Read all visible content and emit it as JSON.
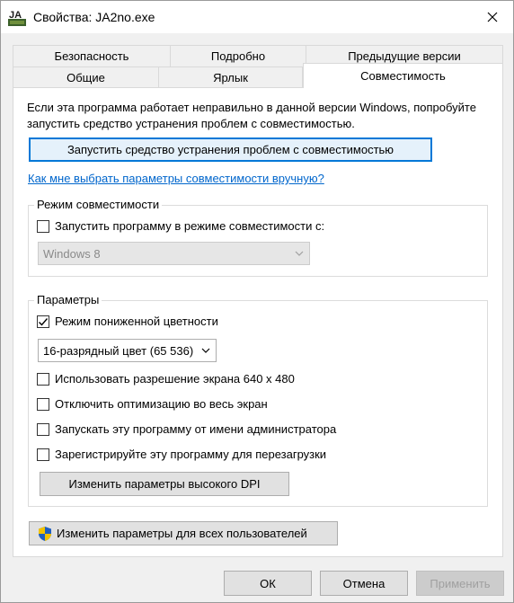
{
  "window": {
    "title": "Свойства: JA2no.exe",
    "app_icon_label": "JA"
  },
  "tabs": {
    "row1": [
      "Безопасность",
      "Подробно",
      "Предыдущие версии"
    ],
    "row2": [
      "Общие",
      "Ярлык",
      "Совместимость"
    ],
    "active": "Совместимость"
  },
  "compat": {
    "intro": "Если эта программа работает неправильно в данной версии Windows, попробуйте запустить средство устранения проблем с совместимостью.",
    "troubleshoot_button": "Запустить средство устранения проблем с совместимостью",
    "manual_link": "Как мне выбрать параметры совместимости вручную?"
  },
  "compat_mode": {
    "legend": "Режим совместимости",
    "checkbox_label": "Запустить программу в режиме совместимости с:",
    "checked": false,
    "os_select_value": "Windows 8"
  },
  "settings": {
    "legend": "Параметры",
    "reduced_color_label": "Режим пониженной цветности",
    "reduced_color_checked": true,
    "color_select_value": "16-разрядный цвет (65 536)",
    "res_640_label": "Использовать разрешение экрана 640 x 480",
    "disable_fullscreen_label": "Отключить оптимизацию во весь экран",
    "run_as_admin_label": "Запускать эту программу от имени администратора",
    "register_restart_label": "Зарегистрируйте эту программу для перезагрузки",
    "dpi_button": "Изменить параметры высокого DPI"
  },
  "all_users_button": "Изменить параметры для всех пользователей",
  "footer": {
    "ok": "ОК",
    "cancel": "Отмена",
    "apply": "Применить"
  },
  "colors": {
    "accent": "#0078d7",
    "link": "#0066cc",
    "shield_blue": "#1f5fbf",
    "shield_yellow": "#f2c200"
  }
}
